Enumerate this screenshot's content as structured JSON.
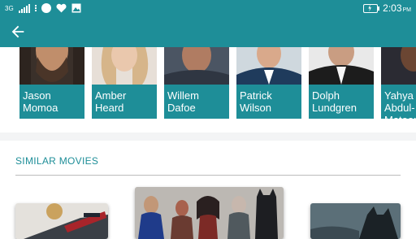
{
  "status_bar": {
    "network": "3G",
    "time": "2:03",
    "ampm": "PM",
    "icons": [
      "signal-icon",
      "more-icon",
      "whatsapp-icon",
      "heart-icon",
      "photo-icon",
      "battery-charging-icon"
    ]
  },
  "toolbar": {
    "back_icon": "arrow-back-icon"
  },
  "cast": [
    {
      "first": "Jason",
      "last": "Momoa"
    },
    {
      "first": "Amber",
      "last": "Heard"
    },
    {
      "first": "Willem",
      "last": "Dafoe"
    },
    {
      "first": "Patrick",
      "last": "Wilson"
    },
    {
      "first": "Dolph",
      "last": "Lundgren"
    },
    {
      "first": "Yahya",
      "last": "Abdul-Mateen II"
    }
  ],
  "similar": {
    "title": "SIMILAR MOVIES"
  },
  "colors": {
    "primary": "#1e8e98"
  }
}
